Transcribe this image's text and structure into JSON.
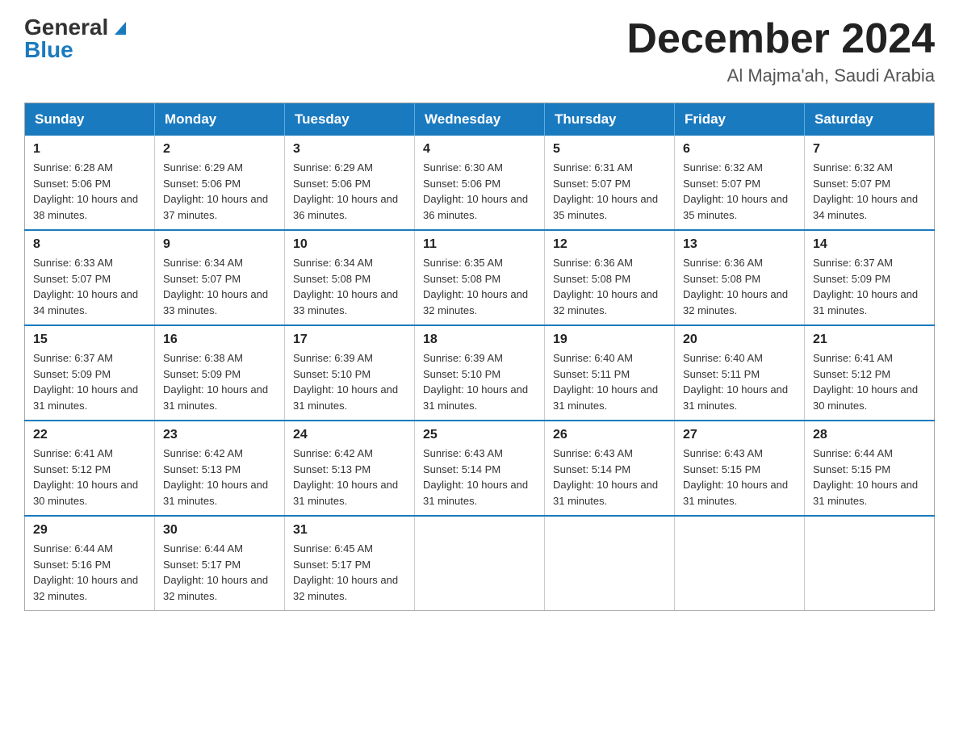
{
  "header": {
    "logo_general": "General",
    "logo_blue": "Blue",
    "month_title": "December 2024",
    "location": "Al Majma'ah, Saudi Arabia"
  },
  "days_of_week": [
    "Sunday",
    "Monday",
    "Tuesday",
    "Wednesday",
    "Thursday",
    "Friday",
    "Saturday"
  ],
  "weeks": [
    [
      {
        "day": "1",
        "sunrise": "6:28 AM",
        "sunset": "5:06 PM",
        "daylight": "10 hours and 38 minutes."
      },
      {
        "day": "2",
        "sunrise": "6:29 AM",
        "sunset": "5:06 PM",
        "daylight": "10 hours and 37 minutes."
      },
      {
        "day": "3",
        "sunrise": "6:29 AM",
        "sunset": "5:06 PM",
        "daylight": "10 hours and 36 minutes."
      },
      {
        "day": "4",
        "sunrise": "6:30 AM",
        "sunset": "5:06 PM",
        "daylight": "10 hours and 36 minutes."
      },
      {
        "day": "5",
        "sunrise": "6:31 AM",
        "sunset": "5:07 PM",
        "daylight": "10 hours and 35 minutes."
      },
      {
        "day": "6",
        "sunrise": "6:32 AM",
        "sunset": "5:07 PM",
        "daylight": "10 hours and 35 minutes."
      },
      {
        "day": "7",
        "sunrise": "6:32 AM",
        "sunset": "5:07 PM",
        "daylight": "10 hours and 34 minutes."
      }
    ],
    [
      {
        "day": "8",
        "sunrise": "6:33 AM",
        "sunset": "5:07 PM",
        "daylight": "10 hours and 34 minutes."
      },
      {
        "day": "9",
        "sunrise": "6:34 AM",
        "sunset": "5:07 PM",
        "daylight": "10 hours and 33 minutes."
      },
      {
        "day": "10",
        "sunrise": "6:34 AM",
        "sunset": "5:08 PM",
        "daylight": "10 hours and 33 minutes."
      },
      {
        "day": "11",
        "sunrise": "6:35 AM",
        "sunset": "5:08 PM",
        "daylight": "10 hours and 32 minutes."
      },
      {
        "day": "12",
        "sunrise": "6:36 AM",
        "sunset": "5:08 PM",
        "daylight": "10 hours and 32 minutes."
      },
      {
        "day": "13",
        "sunrise": "6:36 AM",
        "sunset": "5:08 PM",
        "daylight": "10 hours and 32 minutes."
      },
      {
        "day": "14",
        "sunrise": "6:37 AM",
        "sunset": "5:09 PM",
        "daylight": "10 hours and 31 minutes."
      }
    ],
    [
      {
        "day": "15",
        "sunrise": "6:37 AM",
        "sunset": "5:09 PM",
        "daylight": "10 hours and 31 minutes."
      },
      {
        "day": "16",
        "sunrise": "6:38 AM",
        "sunset": "5:09 PM",
        "daylight": "10 hours and 31 minutes."
      },
      {
        "day": "17",
        "sunrise": "6:39 AM",
        "sunset": "5:10 PM",
        "daylight": "10 hours and 31 minutes."
      },
      {
        "day": "18",
        "sunrise": "6:39 AM",
        "sunset": "5:10 PM",
        "daylight": "10 hours and 31 minutes."
      },
      {
        "day": "19",
        "sunrise": "6:40 AM",
        "sunset": "5:11 PM",
        "daylight": "10 hours and 31 minutes."
      },
      {
        "day": "20",
        "sunrise": "6:40 AM",
        "sunset": "5:11 PM",
        "daylight": "10 hours and 31 minutes."
      },
      {
        "day": "21",
        "sunrise": "6:41 AM",
        "sunset": "5:12 PM",
        "daylight": "10 hours and 30 minutes."
      }
    ],
    [
      {
        "day": "22",
        "sunrise": "6:41 AM",
        "sunset": "5:12 PM",
        "daylight": "10 hours and 30 minutes."
      },
      {
        "day": "23",
        "sunrise": "6:42 AM",
        "sunset": "5:13 PM",
        "daylight": "10 hours and 31 minutes."
      },
      {
        "day": "24",
        "sunrise": "6:42 AM",
        "sunset": "5:13 PM",
        "daylight": "10 hours and 31 minutes."
      },
      {
        "day": "25",
        "sunrise": "6:43 AM",
        "sunset": "5:14 PM",
        "daylight": "10 hours and 31 minutes."
      },
      {
        "day": "26",
        "sunrise": "6:43 AM",
        "sunset": "5:14 PM",
        "daylight": "10 hours and 31 minutes."
      },
      {
        "day": "27",
        "sunrise": "6:43 AM",
        "sunset": "5:15 PM",
        "daylight": "10 hours and 31 minutes."
      },
      {
        "day": "28",
        "sunrise": "6:44 AM",
        "sunset": "5:15 PM",
        "daylight": "10 hours and 31 minutes."
      }
    ],
    [
      {
        "day": "29",
        "sunrise": "6:44 AM",
        "sunset": "5:16 PM",
        "daylight": "10 hours and 32 minutes."
      },
      {
        "day": "30",
        "sunrise": "6:44 AM",
        "sunset": "5:17 PM",
        "daylight": "10 hours and 32 minutes."
      },
      {
        "day": "31",
        "sunrise": "6:45 AM",
        "sunset": "5:17 PM",
        "daylight": "10 hours and 32 minutes."
      },
      null,
      null,
      null,
      null
    ]
  ],
  "labels": {
    "sunrise": "Sunrise:",
    "sunset": "Sunset:",
    "daylight": "Daylight:"
  }
}
